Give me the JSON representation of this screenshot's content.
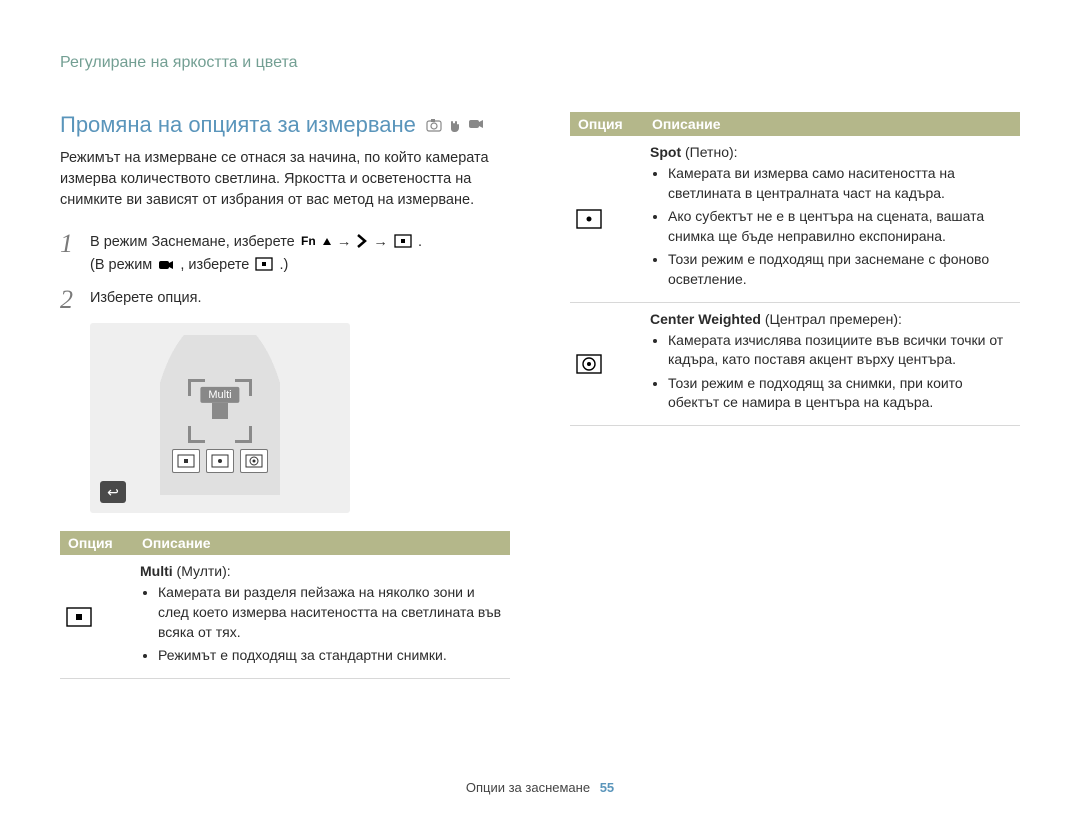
{
  "breadcrumb": "Регулиране на яркостта и цвета",
  "section_title": "Промяна на опцията за измерване",
  "intro": "Режимът на измерване се отнася за начина, по който камерата измерва количеството светлина. Яркостта и осветеността на снимките ви зависят от избрания от вас метод на измерване.",
  "steps": {
    "1": {
      "prefix": "В режим Заснемане, изберете ",
      "icon1": "Fn▲",
      "arrow1": " → ",
      "arrow2": " → ",
      "suffix1": ".",
      "line2_prefix": "(В режим ",
      "line2_mid": ", изберете ",
      "line2_suffix": ".)"
    },
    "2": {
      "text": "Изберете опция."
    }
  },
  "screen": {
    "multi_label": "Multi",
    "back_label": "↩"
  },
  "table_headers": {
    "option": "Опция",
    "description": "Описание"
  },
  "options": {
    "multi": {
      "title_bold": "Multi",
      "title_rest": " (Мулти):",
      "bullets": [
        "Камерата ви разделя пейзажа на няколко зони и след което измерва наситеността на светлината във всяка от тях.",
        "Режимът е подходящ за стандартни снимки."
      ]
    },
    "spot": {
      "title_bold": "Spot",
      "title_rest": " (Петно):",
      "bullets": [
        "Камерата ви измерва само наситеността на светлината в централната част на кадъра.",
        "Ако субектът не е в центъра на сцената, вашата снимка ще бъде неправилно експонирана.",
        "Този режим е подходящ при заснемане с фоново осветление."
      ]
    },
    "center": {
      "title_bold": "Center Weighted",
      "title_rest": " (Централ премерен):",
      "bullets": [
        "Камерата изчислява позициите във всички точки от кадъра, като поставя акцент върху центъра.",
        "Този режим е подходящ за снимки, при които обектът се намира в центъра на кадъра."
      ]
    }
  },
  "footer": {
    "section": "Опции за заснемане",
    "page": "55"
  }
}
